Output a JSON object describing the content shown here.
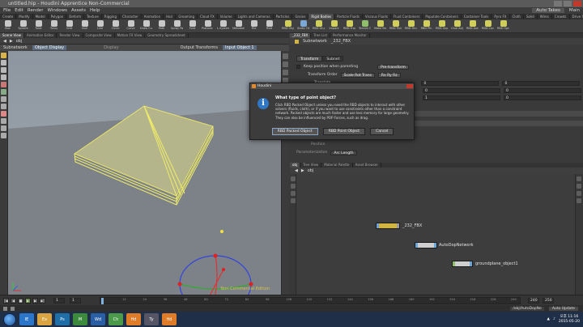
{
  "window": {
    "title": "untitled.hip - Houdini Apprentice Non-Commercial"
  },
  "menubar": {
    "items": [
      "File",
      "Edit",
      "Render",
      "Windows",
      "Assets",
      "Help"
    ],
    "auto_takes": "Auto Takes",
    "main": "Main"
  },
  "shelf_tabs": [
    "Create",
    "Modify",
    "Model",
    "Polygon",
    "Deform",
    "Texture",
    "Rigging",
    "Character",
    "Animation",
    "Hair",
    "Grooming",
    "Cloud FX",
    "Volume",
    "Lights and Cameras",
    "Particles",
    "Grains",
    "Rigid Bodies",
    "Particle Fluids",
    "Viscous Fluids",
    "Fluid Containers",
    "Populate Containers",
    "Container Tools",
    "Pyro FX",
    "Cloth",
    "Solid",
    "Wires",
    "Crowds",
    "Drive Simulation"
  ],
  "shelf_tools_left": [
    {
      "label": "Box",
      "color": "#c8c8c8"
    },
    {
      "label": "Sphere",
      "color": "#c8c8c8"
    },
    {
      "label": "Tube",
      "color": "#c8c8c8"
    },
    {
      "label": "Torus",
      "color": "#c8c8c8"
    },
    {
      "label": "Grid",
      "color": "#c8c8c8"
    },
    {
      "label": "Null",
      "color": "#c8c8c8"
    },
    {
      "label": "Line",
      "color": "#c8c8c8"
    },
    {
      "label": "Circle",
      "color": "#c8c8c8"
    },
    {
      "label": "Curve",
      "color": "#c8c8c8"
    },
    {
      "label": "Draw Curve",
      "color": "#c8c8c8"
    },
    {
      "label": "Path",
      "color": "#c8c8c8"
    },
    {
      "label": "Spray Paint",
      "color": "#c8c8c8"
    },
    {
      "label": "Font",
      "color": "#c8c8c8"
    },
    {
      "label": "Platonic Solids",
      "color": "#c8c8c8"
    },
    {
      "label": "L-System",
      "color": "#c8c8c8"
    },
    {
      "label": "Metaball",
      "color": "#c8c8c8"
    },
    {
      "label": "File",
      "color": "#c8c8c8"
    },
    {
      "label": "Rbd",
      "color": "#c8c8c8"
    }
  ],
  "shelf_tools_right": [
    {
      "label": "RBD Object",
      "color": "#cfcf5a"
    },
    {
      "label": "Static Object",
      "color": "#7aa7d6"
    },
    {
      "label": "RBD Glue",
      "color": "#cfcf5a"
    },
    {
      "label": "Impact",
      "color": "#cfcf5a"
    },
    {
      "label": "RBD Fractured",
      "color": "#cfcf5a"
    },
    {
      "label": "Terrain Object",
      "color": "#8fbf6a"
    },
    {
      "label": "Make Breakable",
      "color": "#cfcf5a"
    },
    {
      "label": "RBD Point",
      "color": "#cfcf5a"
    },
    {
      "label": "RBD Hinge",
      "color": "#cfcf5a"
    },
    {
      "label": "RBD Pin",
      "color": "#cfcf5a"
    },
    {
      "label": "RBD Impulse",
      "color": "#cfcf5a"
    },
    {
      "label": "Glue Adjacent",
      "color": "#cfcf5a"
    },
    {
      "label": "RBD Auto F",
      "color": "#cfcf5a"
    },
    {
      "label": "RBD Cone T",
      "color": "#cfcf5a"
    },
    {
      "label": "RBD Spring",
      "color": "#cfcf5a"
    }
  ],
  "left_pane": {
    "tabs": [
      "Scene View",
      "Animation Editor",
      "Render View",
      "Composite View",
      "Motion FX View",
      "Geometry Spreadsheet"
    ],
    "path": "obj",
    "viewport_title": "Subnetwork",
    "display_label": "Object Display",
    "display_mode": "Display",
    "output_transforms": "Output Transforms",
    "input_object": "Input Object 1",
    "watermark": "Non-Commercial Edition"
  },
  "right_pane": {
    "tabs": [
      "_232_FBX",
      "Tree List",
      "Performance Monitor"
    ],
    "node_type": "Subnetwork",
    "node_name": "_232_FBX",
    "parm_tabs": [
      "Transform",
      "Subnet"
    ],
    "keep_position": "Keep position when parenting",
    "pre_transform": "Pre-transform",
    "transform_order_label": "Transform Order",
    "transform_order": "Scale Rot Trans",
    "rot_order": "Rx Ry Rz",
    "translate_label": "Translate",
    "values": [
      "0",
      "0",
      "0",
      "0",
      "1",
      "0"
    ],
    "pivot_label": "Pivot",
    "position_label": "Position",
    "parameterization_label": "Parameterization",
    "arc_length": "Arc Length"
  },
  "dialog": {
    "app_title": "Houdini",
    "question": "What type of point object?",
    "message": "Click RBD Packed Object unless you need the RBD objects to interact with other solvers (fluids, cloth), or if you want to use constraints other than a constraint network. Packed objects are much faster and use less memory for large geometry. They can also be influenced by POP Forces, such as drag.",
    "buttons": [
      "RBD Packed Object",
      "RBD Point Object",
      "Cancel"
    ]
  },
  "net_pane": {
    "tabs": [
      "obj",
      "Tree View",
      "Material Palette",
      "Asset Browser"
    ],
    "path": "obj",
    "nodes": [
      {
        "name": "_232_FBX",
        "color": "#d2b341"
      },
      {
        "name": "AutoDopNetwork",
        "color": "#6aa7d8"
      },
      {
        "name": "groundplane_object1",
        "color": "#8a8a8a"
      }
    ]
  },
  "timeline": {
    "start": "1",
    "current": "1",
    "end": "240",
    "end_field": "250",
    "ticks": [
      "1",
      "12",
      "24",
      "36",
      "48",
      "60",
      "72",
      "84",
      "96",
      "108",
      "120",
      "132",
      "144",
      "156",
      "168",
      "180",
      "192",
      "204",
      "216",
      "228",
      "240"
    ]
  },
  "statusbar": {
    "path": "/obj/AutoDopNe",
    "auto_update": "Auto Update"
  },
  "taskbar": {
    "apps": [
      "IE",
      "Ex",
      "Ps",
      "M",
      "Wd",
      "Ch",
      "Hd",
      "Ty",
      "Hd"
    ],
    "time": "오후 11:16",
    "date": "2015-05-20"
  }
}
